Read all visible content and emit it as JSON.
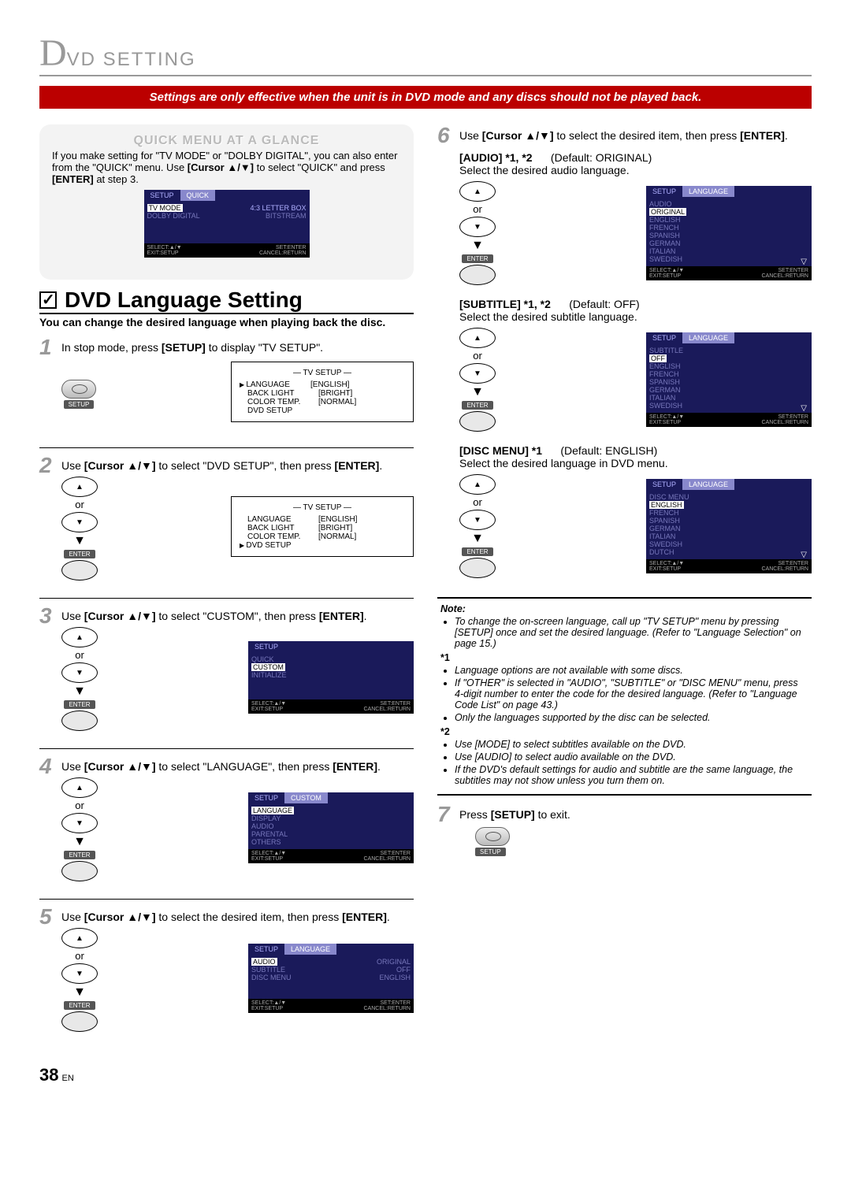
{
  "header": {
    "letter": "D",
    "rest": "VD SETTING"
  },
  "red_bar": "Settings are only effective when the unit is in DVD mode and any discs should not be played back.",
  "quick": {
    "title": "QUICK MENU AT A GLANCE",
    "text_a": "If you make setting for \"TV MODE\" or \"DOLBY DIGITAL\", you can also enter from the \"QUICK\" menu. Use ",
    "text_b": "[Cursor ▲/▼]",
    "text_c": " to select \"QUICK\" and press ",
    "text_d": "[ENTER]",
    "text_e": " at step 3.",
    "osd": {
      "tab1": "SETUP",
      "tab2": "QUICK",
      "row1a": "TV MODE",
      "row1b": "4:3 LETTER BOX",
      "row2a": "DOLBY DIGITAL",
      "row2b": "BITSTREAM",
      "f1": "SELECT:▲/▼",
      "f2": "SET:ENTER",
      "f3": "EXIT:SETUP",
      "f4": "CANCEL:RETURN"
    }
  },
  "section_title": "DVD Language Setting",
  "section_sub": "You can change the desired language when playing back the disc.",
  "steps": {
    "s1": {
      "num": "1",
      "a": "In stop mode, press ",
      "b": "[SETUP]",
      "c": " to display \"TV SETUP\"."
    },
    "s2": {
      "num": "2",
      "a": "Use ",
      "b": "[Cursor ▲/▼]",
      "c": " to select \"DVD SETUP\", then press ",
      "d": "[ENTER]",
      "e": "."
    },
    "s3": {
      "num": "3",
      "a": "Use ",
      "b": "[Cursor ▲/▼]",
      "c": " to select \"CUSTOM\", then press ",
      "d": "[ENTER]",
      "e": "."
    },
    "s4": {
      "num": "4",
      "a": "Use ",
      "b": "[Cursor ▲/▼]",
      "c": " to select \"LANGUAGE\", then press ",
      "d": "[ENTER]",
      "e": "."
    },
    "s5": {
      "num": "5",
      "a": "Use ",
      "b": "[Cursor ▲/▼]",
      "c": " to select the desired item, then press ",
      "d": "[ENTER]",
      "e": "."
    },
    "s6": {
      "num": "6",
      "a": "Use ",
      "b": "[Cursor ▲/▼]",
      "c": " to select the desired item, then press ",
      "d": "[ENTER]",
      "e": "."
    },
    "s7": {
      "num": "7",
      "a": "Press ",
      "b": "[SETUP]",
      "c": " to exit."
    }
  },
  "tvsetup1": {
    "title": "— TV SETUP —",
    "r1a": "LANGUAGE",
    "r1b": "[ENGLISH]",
    "r2a": "BACK LIGHT",
    "r2b": "[BRIGHT]",
    "r3a": "COLOR TEMP.",
    "r3b": "[NORMAL]",
    "r4a": "DVD SETUP"
  },
  "osd3": {
    "tab1": "SETUP",
    "r1": "QUICK",
    "r2": "CUSTOM",
    "r3": "INITIALIZE",
    "f1": "SELECT:▲/▼",
    "f2": "SET:ENTER",
    "f3": "EXIT:SETUP",
    "f4": "CANCEL:RETURN"
  },
  "osd4": {
    "tab1": "SETUP",
    "tab2": "CUSTOM",
    "r1": "LANGUAGE",
    "r2": "DISPLAY",
    "r3": "AUDIO",
    "r4": "PARENTAL",
    "r5": "OTHERS",
    "f1": "SELECT:▲/▼",
    "f2": "SET:ENTER",
    "f3": "EXIT:SETUP",
    "f4": "CANCEL:RETURN"
  },
  "osd5": {
    "tab1": "SETUP",
    "tab2": "LANGUAGE",
    "r1a": "AUDIO",
    "r1b": "ORIGINAL",
    "r2a": "SUBTITLE",
    "r2b": "OFF",
    "r3a": "DISC MENU",
    "r3b": "ENGLISH",
    "f1": "SELECT:▲/▼",
    "f2": "SET:ENTER",
    "f3": "EXIT:SETUP",
    "f4": "CANCEL:RETURN"
  },
  "audio": {
    "hd": "[AUDIO] *1, *2",
    "def": "(Default: ORIGINAL)",
    "desc": "Select the desired audio language.",
    "osd": {
      "tab1": "SETUP",
      "tab2": "LANGUAGE",
      "cat": "AUDIO",
      "opts": [
        "ORIGINAL",
        "ENGLISH",
        "FRENCH",
        "SPANISH",
        "GERMAN",
        "ITALIAN",
        "SWEDISH"
      ],
      "f1": "SELECT:▲/▼",
      "f2": "SET:ENTER",
      "f3": "EXIT:SETUP",
      "f4": "CANCEL:RETURN"
    }
  },
  "subtitle": {
    "hd": "[SUBTITLE] *1, *2",
    "def": "(Default: OFF)",
    "desc": "Select the desired subtitle language.",
    "osd": {
      "tab1": "SETUP",
      "tab2": "LANGUAGE",
      "cat": "SUBTITLE",
      "opts": [
        "OFF",
        "ENGLISH",
        "FRENCH",
        "SPANISH",
        "GERMAN",
        "ITALIAN",
        "SWEDISH"
      ],
      "f1": "SELECT:▲/▼",
      "f2": "SET:ENTER",
      "f3": "EXIT:SETUP",
      "f4": "CANCEL:RETURN"
    }
  },
  "discmenu": {
    "hd": "[DISC MENU] *1",
    "def": "(Default: ENGLISH)",
    "desc": "Select the desired language in DVD menu.",
    "osd": {
      "tab1": "SETUP",
      "tab2": "LANGUAGE",
      "cat": "DISC MENU",
      "opts": [
        "ENGLISH",
        "FRENCH",
        "SPANISH",
        "GERMAN",
        "ITALIAN",
        "SWEDISH",
        "DUTCH"
      ],
      "f1": "SELECT:▲/▼",
      "f2": "SET:ENTER",
      "f3": "EXIT:SETUP",
      "f4": "CANCEL:RETURN"
    }
  },
  "note": {
    "hd": "Note:",
    "b1": "To change the on-screen language, call up \"TV SETUP\" menu by pressing [SETUP] once and set the desired language. (Refer to \"Language Selection\" on page 15.)",
    "s1": "*1",
    "b2": "Language options are not available with some discs.",
    "b3": "If \"OTHER\" is selected in \"AUDIO\", \"SUBTITLE\" or \"DISC MENU\" menu, press 4-digit number to enter the code for the desired language. (Refer to \"Language Code List\" on page 43.)",
    "b4": "Only the languages supported by the disc can be selected.",
    "s2": "*2",
    "b5": "Use [MODE] to select subtitles available on the DVD.",
    "b6": "Use [AUDIO] to select audio available on the DVD.",
    "b7": "If the DVD's default settings for audio and subtitle are the same language, the subtitles may not show unless you turn them on."
  },
  "labels": {
    "or": "or",
    "enter": "ENTER",
    "setup": "SETUP",
    "up": "▲",
    "down": "▼"
  },
  "page": {
    "num": "38",
    "en": "EN"
  }
}
